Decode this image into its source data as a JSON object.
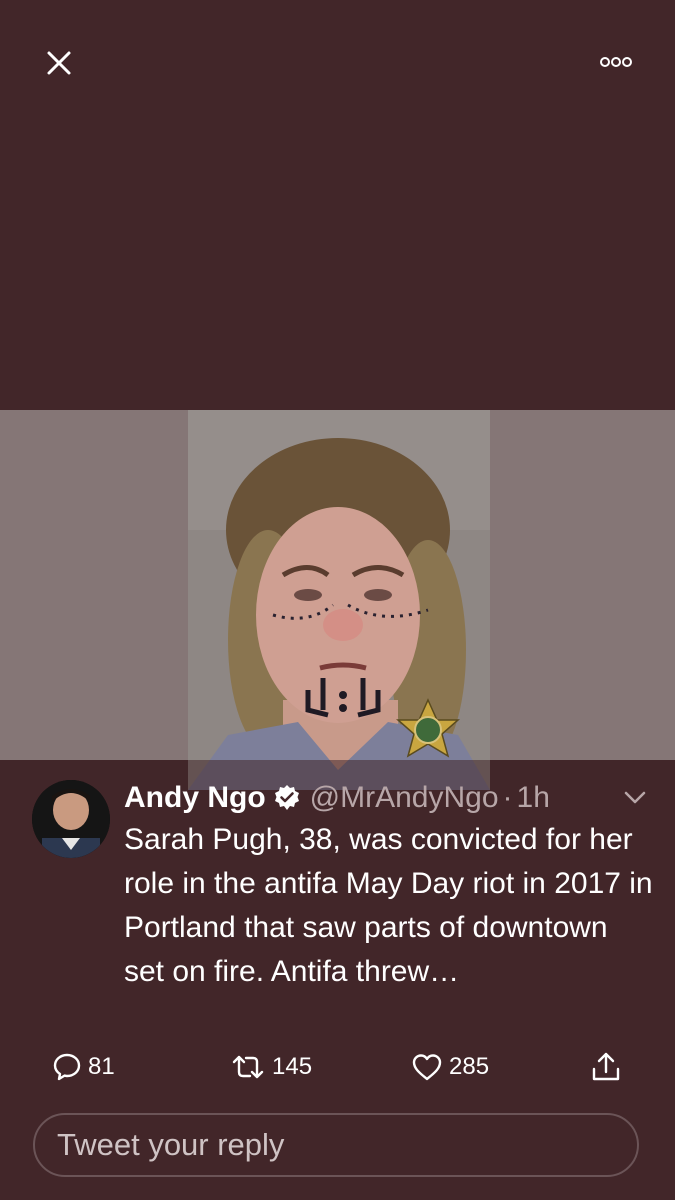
{
  "top_bar": {
    "close_icon": "close-icon",
    "more_icon": "more-options-icon"
  },
  "media": {
    "photo_description_icon": "mugshot-photo",
    "badge": "sheriff-badge"
  },
  "tweet": {
    "display_name": "Andy Ngo",
    "verified_icon": "verified-badge-icon",
    "handle": "@MrAndyNgo",
    "separator": "·",
    "time": "1h",
    "text": "Sarah Pugh, 38, was convicted for her role in the antifa May Day riot in 2017 in Portland that saw parts of downtown set on fire. Antifa threw…"
  },
  "actions": {
    "reply_count": "81",
    "retweet_count": "145",
    "like_count": "285"
  },
  "reply": {
    "placeholder": "Tweet your reply"
  },
  "colors": {
    "background": "#422629",
    "media_band": "#857676",
    "secondary_text": "#b7a6a8"
  }
}
